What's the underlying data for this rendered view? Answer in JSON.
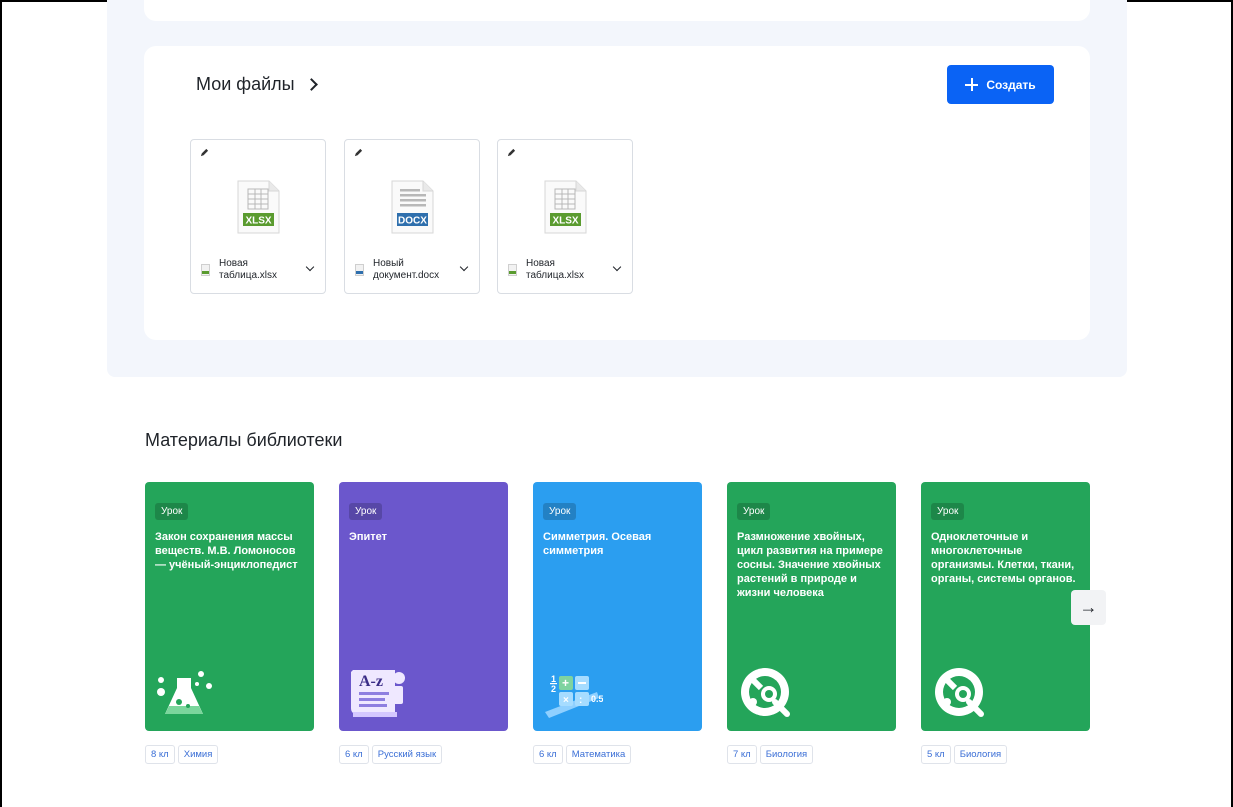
{
  "files_section": {
    "title": "Мои файлы",
    "create_label": "Создать",
    "files": [
      {
        "name": "Новая таблица.xlsx",
        "type": "XLSX",
        "badge_color": "#5a9b2f"
      },
      {
        "name": "Новый документ.docx",
        "type": "DOCX",
        "badge_color": "#2e6fad"
      },
      {
        "name": "Новая таблица.xlsx",
        "type": "XLSX",
        "badge_color": "#5a9b2f"
      }
    ]
  },
  "library": {
    "title": "Материалы библиотеки",
    "cards": [
      {
        "badge": "Урок",
        "title": "Закон сохранения массы веществ. М.В. Ломоносов — учёный-энциклопедист",
        "grade": "8 кл",
        "subject": "Химия",
        "color": "#24a55a",
        "icon": "flask-icon"
      },
      {
        "badge": "Урок",
        "title": "Эпитет",
        "grade": "6 кл",
        "subject": "Русский язык",
        "color": "#6b57cc",
        "icon": "dictionary-icon"
      },
      {
        "badge": "Урок",
        "title": "Симметрия. Осевая симметрия",
        "grade": "6 кл",
        "subject": "Математика",
        "color": "#2b9ef0",
        "icon": "math-icon"
      },
      {
        "badge": "Урок",
        "title": "Размножение хвойных, цикл развития на примере сосны. Значение хвойных растений в природе и жизни человека",
        "grade": "7 кл",
        "subject": "Биология",
        "color": "#24a55a",
        "icon": "microscope-icon"
      },
      {
        "badge": "Урок",
        "title": "Одноклеточные и многоклеточные организмы. Клетки, ткани, органы, системы органов.",
        "grade": "5 кл",
        "subject": "Биология",
        "color": "#24a55a",
        "icon": "microscope-icon"
      }
    ],
    "next_icon": "→"
  }
}
